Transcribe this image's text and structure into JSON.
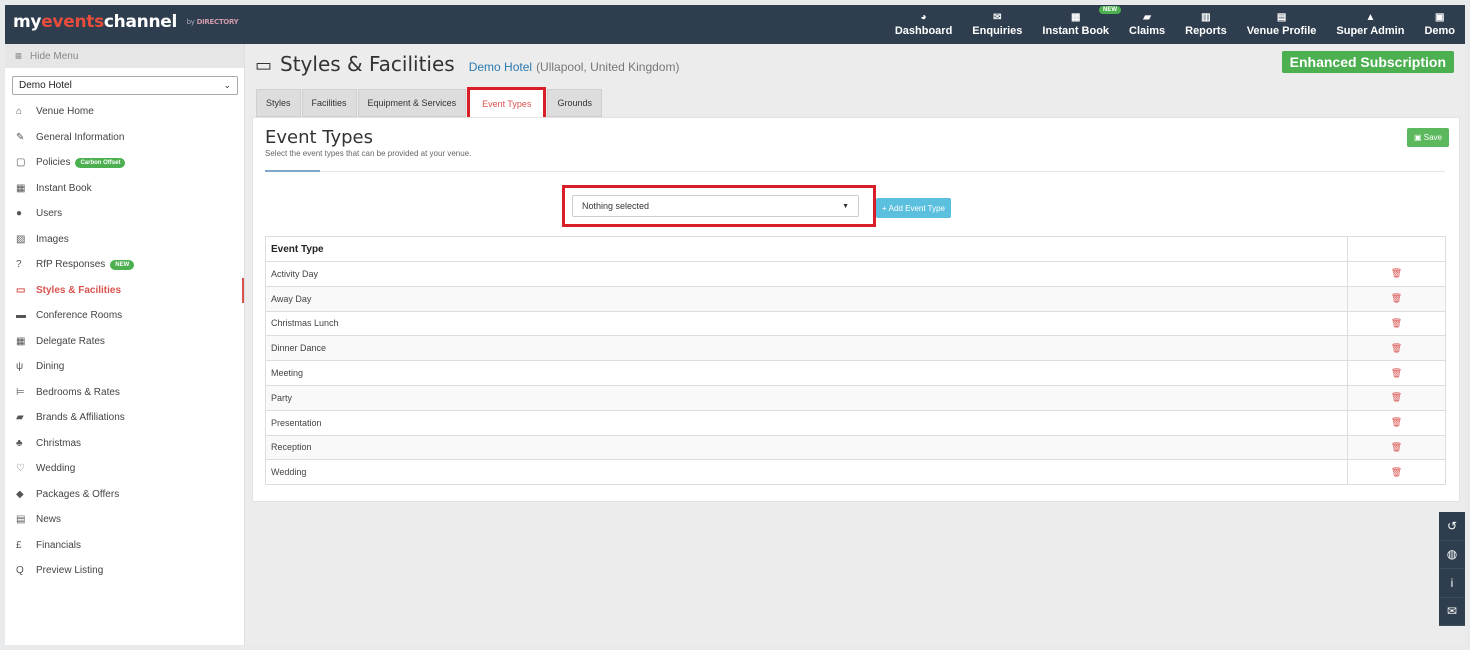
{
  "brand": {
    "prefix": "my",
    "accent": "events",
    "suffix": "channel",
    "by": "by",
    "partner": "DIRECTORY"
  },
  "topnav": [
    {
      "label": "Dashboard",
      "icon": "dashboard-icon",
      "glyph": "◕"
    },
    {
      "label": "Enquiries",
      "icon": "envelope-icon",
      "glyph": "✉"
    },
    {
      "label": "Instant Book",
      "icon": "calendar-icon",
      "glyph": "▦",
      "badge": "NEW"
    },
    {
      "label": "Claims",
      "icon": "book-icon",
      "glyph": "▰"
    },
    {
      "label": "Reports",
      "icon": "bar-chart-icon",
      "glyph": "▥"
    },
    {
      "label": "Venue Profile",
      "icon": "building-icon",
      "glyph": "▤"
    },
    {
      "label": "Super Admin",
      "icon": "lock-icon",
      "glyph": "▲"
    },
    {
      "label": "Demo",
      "icon": "user-icon",
      "glyph": "▣"
    }
  ],
  "sidebar": {
    "hide_label": "Hide Menu",
    "venue_select": "Demo Hotel",
    "items": [
      {
        "label": "Venue Home",
        "icon": "home-icon",
        "glyph": "⌂"
      },
      {
        "label": "General Information",
        "icon": "edit-icon",
        "glyph": "✎"
      },
      {
        "label": "Policies",
        "icon": "file-icon",
        "glyph": "▢",
        "tag": "Carbon Offset"
      },
      {
        "label": "Instant Book",
        "icon": "calendar-icon",
        "glyph": "▦"
      },
      {
        "label": "Users",
        "icon": "user-icon",
        "glyph": "●"
      },
      {
        "label": "Images",
        "icon": "image-icon",
        "glyph": "▨"
      },
      {
        "label": "RfP Responses",
        "icon": "question-icon",
        "glyph": "?",
        "tag": "NEW"
      },
      {
        "label": "Styles & Facilities",
        "icon": "monitor-icon",
        "glyph": "▭",
        "active": true
      },
      {
        "label": "Conference Rooms",
        "icon": "briefcase-icon",
        "glyph": "▬"
      },
      {
        "label": "Delegate Rates",
        "icon": "calculator-icon",
        "glyph": "▦"
      },
      {
        "label": "Dining",
        "icon": "cutlery-icon",
        "glyph": "ψ"
      },
      {
        "label": "Bedrooms & Rates",
        "icon": "bed-icon",
        "glyph": "⊨"
      },
      {
        "label": "Brands & Affiliations",
        "icon": "book-icon",
        "glyph": "▰"
      },
      {
        "label": "Christmas",
        "icon": "tree-icon",
        "glyph": "♣"
      },
      {
        "label": "Wedding",
        "icon": "heart-icon",
        "glyph": "♡"
      },
      {
        "label": "Packages & Offers",
        "icon": "tag-icon",
        "glyph": "◆"
      },
      {
        "label": "News",
        "icon": "newspaper-icon",
        "glyph": "▤"
      },
      {
        "label": "Financials",
        "icon": "pound-icon",
        "glyph": "£"
      },
      {
        "label": "Preview Listing",
        "icon": "search-icon",
        "glyph": "Q"
      }
    ]
  },
  "header": {
    "title": "Styles & Facilities",
    "venue_name": "Demo Hotel",
    "venue_location": "(Ullapool, United Kingdom)",
    "subscription": "Enhanced Subscription"
  },
  "tabs": [
    {
      "label": "Styles"
    },
    {
      "label": "Facilities"
    },
    {
      "label": "Equipment & Services"
    },
    {
      "label": "Event Types",
      "active": true
    },
    {
      "label": "Grounds"
    }
  ],
  "panel": {
    "title": "Event Types",
    "subtitle": "Select the event types that can be provided at your venue.",
    "save_label": "Save",
    "select_value": "Nothing selected",
    "add_label": "Add Event Type"
  },
  "table": {
    "header": "Event Type",
    "rows": [
      "Activity Day",
      "Away Day",
      "Christmas Lunch",
      "Dinner Dance",
      "Meeting",
      "Party",
      "Presentation",
      "Reception",
      "Wedding"
    ]
  },
  "float_buttons": [
    {
      "icon": "history-icon",
      "glyph": "↺"
    },
    {
      "icon": "chat-icon",
      "glyph": "◍"
    },
    {
      "icon": "info-icon",
      "glyph": "i"
    },
    {
      "icon": "envelope-icon",
      "glyph": "✉"
    }
  ],
  "colors": {
    "nav": "#2e3e4e",
    "active": "#d9534f",
    "success": "#4caf50",
    "info": "#5bc0de",
    "highlight": "#d91e27"
  }
}
